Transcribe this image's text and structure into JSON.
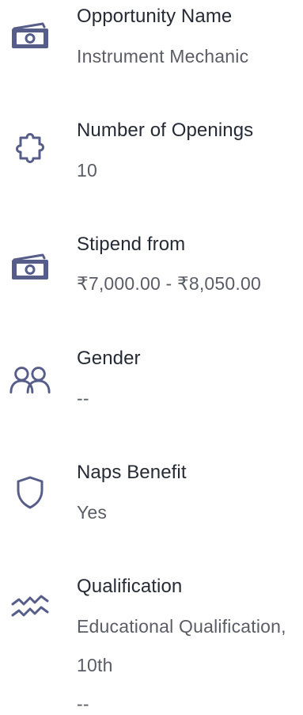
{
  "accent_color": "#575d89",
  "details": [
    {
      "icon": "money-icon",
      "label": "Opportunity Name",
      "value": "Instrument Mechanic"
    },
    {
      "icon": "puzzle-icon",
      "label": "Number of Openings",
      "value": "10"
    },
    {
      "icon": "money-icon",
      "label": "Stipend from",
      "value": "₹7,000.00 - ₹8,050.00"
    },
    {
      "icon": "users-icon",
      "label": "Gender",
      "value": "--"
    },
    {
      "icon": "shield-icon",
      "label": "Naps Benefit",
      "value": "Yes"
    },
    {
      "icon": "squiggle-icon",
      "label": "Qualification",
      "value": "Educational Qualification,",
      "value_lines": [
        "10th",
        "--"
      ]
    }
  ]
}
